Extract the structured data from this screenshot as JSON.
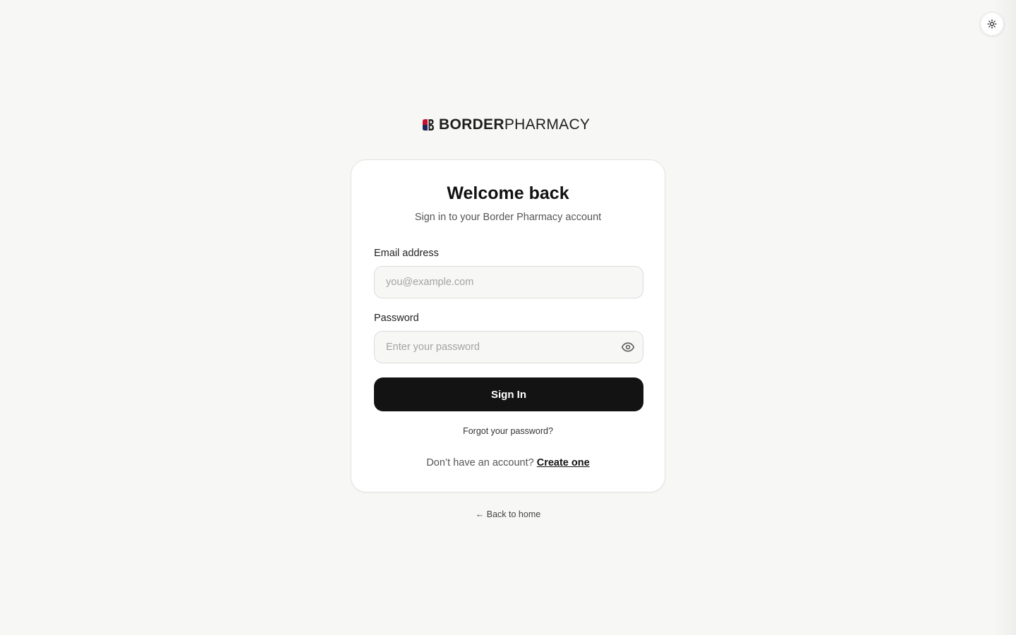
{
  "brand": {
    "name_bold": "BORDER",
    "name_light": "PHARMACY",
    "colors": {
      "red": "#c8102e",
      "navy": "#1b2a5c",
      "dark": "#1e1e1e"
    }
  },
  "theme_toggle": {
    "icon": "sun-icon"
  },
  "card": {
    "title": "Welcome back",
    "subtitle": "Sign in to your Border Pharmacy account",
    "email": {
      "label": "Email address",
      "placeholder": "you@example.com",
      "value": ""
    },
    "password": {
      "label": "Password",
      "placeholder": "Enter your password",
      "value": "",
      "toggle_icon": "eye-icon"
    },
    "signin_label": "Sign In",
    "forgot_label": "Forgot your password?",
    "signup_prompt": "Don’t have an account?",
    "signup_link": "Create one"
  },
  "back_link": "← Back to home"
}
